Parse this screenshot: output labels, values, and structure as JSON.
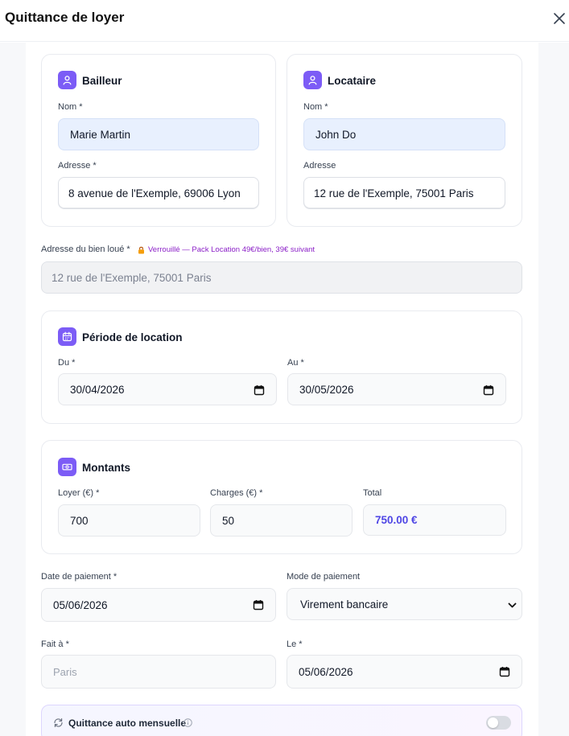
{
  "dialog": {
    "title": "Quittance de loyer"
  },
  "bailleur": {
    "title": "Bailleur",
    "name_label": "Nom *",
    "name_value": "Marie Martin",
    "address_label": "Adresse *",
    "address_value": "8 avenue de l'Exemple, 69006 Lyon"
  },
  "locataire": {
    "title": "Locataire",
    "name_label": "Nom *",
    "name_value": "John Do",
    "address_label": "Adresse",
    "address_value": "12 rue de l'Exemple, 75001 Paris"
  },
  "property": {
    "label": "Adresse du bien loué *",
    "lock_note": "Verrouillé — Pack Location 49€/bien, 39€ suivant",
    "value": "12 rue de l'Exemple, 75001 Paris"
  },
  "period": {
    "title": "Période de location",
    "from_label": "Du *",
    "from_value": "30/04/2026",
    "to_label": "Au *",
    "to_value": "30/05/2026"
  },
  "amounts": {
    "title": "Montants",
    "rent_label": "Loyer (€) *",
    "rent_value": "700",
    "charges_label": "Charges (€) *",
    "charges_value": "50",
    "total_label": "Total",
    "total_value": "750.00 €"
  },
  "payment": {
    "date_label": "Date de paiement *",
    "date_value": "05/06/2026",
    "mode_label": "Mode de paiement",
    "mode_value": "Virement bancaire"
  },
  "signature": {
    "place_label": "Fait à *",
    "place_placeholder": "Paris",
    "date_label": "Le *",
    "date_value": "05/06/2026"
  },
  "auto": {
    "label": "Quittance auto mensuelle",
    "enabled": false
  },
  "colors": {
    "accent": "#7c5cf6",
    "total": "#4f46e5",
    "lock_note": "#8b1fc7"
  }
}
